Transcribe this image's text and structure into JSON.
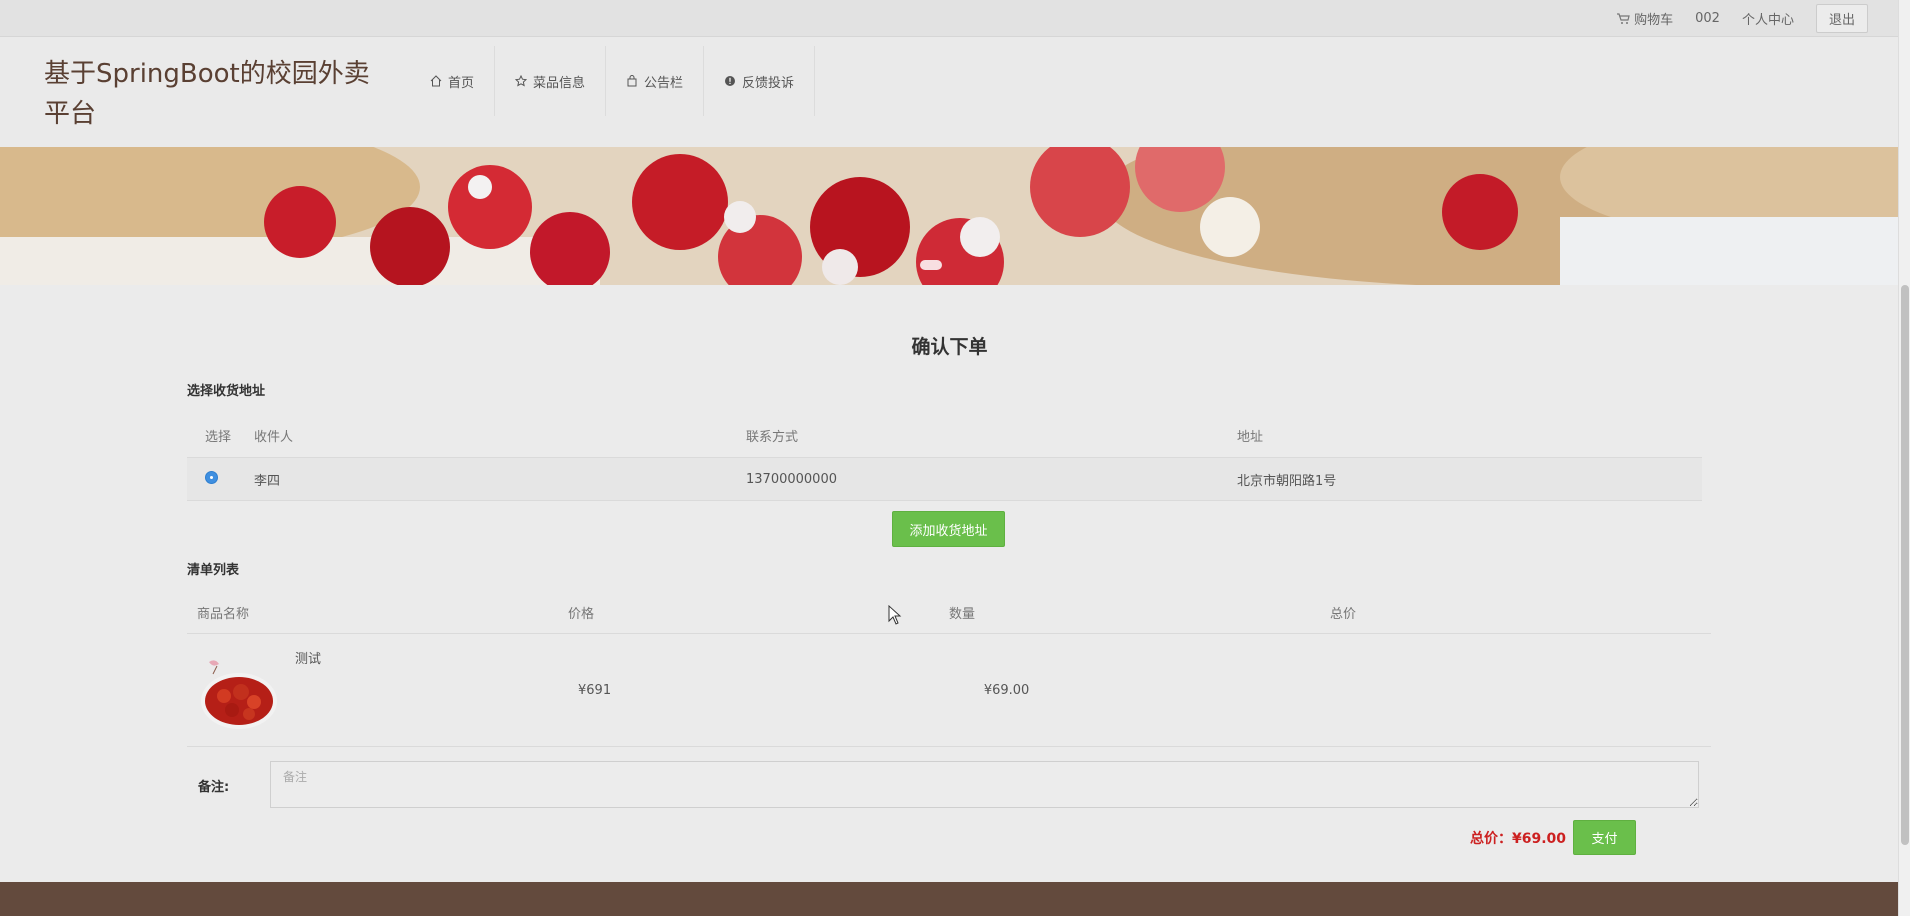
{
  "topbar": {
    "cart_label": "购物车",
    "username": "002",
    "profile_label": "个人中心",
    "logout_label": "退出"
  },
  "site": {
    "title": "基于SpringBoot的校园外卖平台"
  },
  "nav": {
    "items": [
      {
        "label": "首页",
        "icon": "home-icon"
      },
      {
        "label": "菜品信息",
        "icon": "star-icon"
      },
      {
        "label": "公告栏",
        "icon": "bag-icon"
      },
      {
        "label": "反馈投诉",
        "icon": "alert-circle-icon"
      }
    ]
  },
  "page": {
    "title": "确认下单"
  },
  "address": {
    "section_title": "选择收货地址",
    "headers": [
      "选择",
      "收件人",
      "联系方式",
      "地址"
    ],
    "rows": [
      {
        "selected": true,
        "name": "李四",
        "phone": "13700000000",
        "address": "北京市朝阳路1号"
      }
    ],
    "add_button": "添加收货地址"
  },
  "order_list": {
    "section_title": "清单列表",
    "headers": [
      "商品名称",
      "价格",
      "数量",
      "总价"
    ],
    "items": [
      {
        "name": "测试",
        "price": "¥69",
        "quantity": "1",
        "total": "¥69.00"
      }
    ]
  },
  "remark": {
    "label": "备注:",
    "placeholder": "备注"
  },
  "summary": {
    "total_text": "总价：¥69.00",
    "pay_button": "支付"
  },
  "colors": {
    "accent_green": "#6abf4b",
    "price_red": "#cc2020",
    "footer_brown": "#634a3d"
  }
}
